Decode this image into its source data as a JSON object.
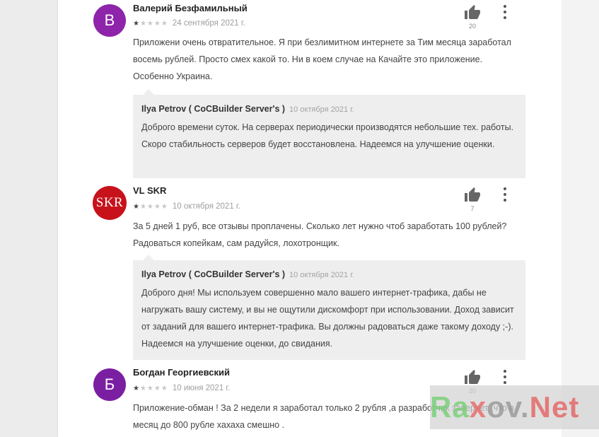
{
  "colors": {
    "avatar_v": "#8e24aa",
    "avatar_skr": "#c8121b",
    "avatar_b": "#7b1fa2",
    "reply_bg": "#eeeeee",
    "page_bg": "#ffffff"
  },
  "reviews": [
    {
      "avatar_letter": "В",
      "author": "Валерий Безфамильный",
      "stars": "1 of 5",
      "date": "24 сентября 2021 г.",
      "text": "Приложени очень отвратительное. Я при безлимитном интернете за Тим месяца заработал восемь рублей. Просто смех какой то. Ни в коем случае на Качайте это приложение. Особенно Украина.",
      "likes": "20",
      "reply": {
        "author": "Ilya Petrov ( CoCBuilder Server's )",
        "date": "10 октября 2021 г.",
        "text": "Доброго времени суток. На серверах периодически производятся небольшие тех. работы. Скоро стабильность серверов будет восстановлена. Надеемся на улучшение оценки."
      }
    },
    {
      "avatar_letter": "SKR",
      "author": "VL SKR",
      "stars": "1 of 5",
      "date": "10 октября 2021 г.",
      "text": "За 5 дней 1 руб, все отзывы проплачены. Сколько лет нужно чтоб заработать 100 рублей? Радоваться копейкам, сам радуйся, лохотронщик.",
      "likes": "7",
      "reply": {
        "author": "Ilya Petrov ( CoCBuilder Server's )",
        "date": "10 октября 2021 г.",
        "text": "Доброго дня! Мы используем совершенно мало вашего интернет-трафика, дабы не нагружать вашу систему, и вы не ощутили дискомфорт при использовании. Доход зависит от заданий для вашего интернет-трафика. Вы должны радоваться даже такому доходу ;-). Надеемся на улучшение оценки, до свидания."
      }
    },
    {
      "avatar_letter": "Б",
      "author": "Богдан Георгиевский",
      "stars": "1 of 5",
      "date": "10 июня 2021 г.",
      "text": "Приложение-обман ! За 2 недели я заработал только 2 рубля ,а разработчик заверяет ,что в месяц до 800 рубле хахаха смешно .",
      "likes": "20"
    }
  ],
  "watermark": {
    "part1": "Ra",
    "part2": "x",
    "part3": "ov.",
    "part4": "Net"
  }
}
